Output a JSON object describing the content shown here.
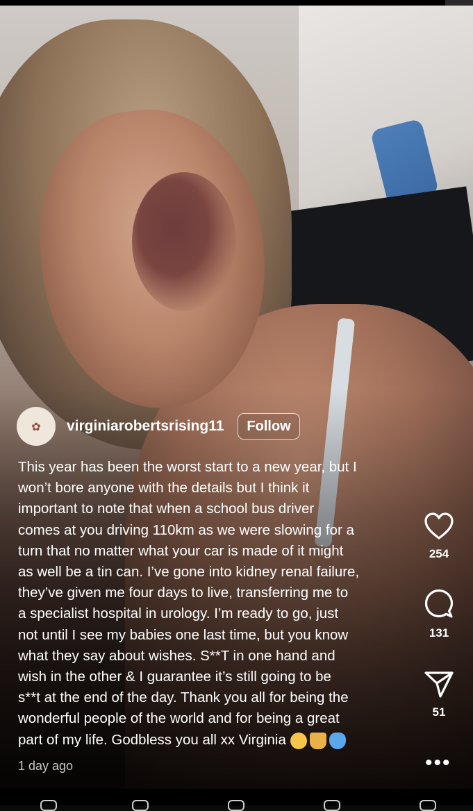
{
  "post": {
    "username": "virginiarobertsrising11",
    "follow_label": "Follow",
    "caption": "This year has been the worst start to a new year, but I\nwon’t bore anyone with the details but I think it\nimportant to note that when a school bus driver\ncomes at you driving 110km as we were slowing for a\nturn that no matter what your car is made of it might\nas well be a tin can. I’ve gone into kidney renal failure,\nthey’ve given me four days to live, transferring me to\na specialist hospital in urology. I’m ready to go, just\nnot until I see my babies one last time, but you know\nwhat they say about wishes. S**T in one hand and\nwish in the other & I guarantee it’s still going to be\ns**t at the end of the day. Thank you all for being the\nwonderful people of the world and for being a great\npart of my life. Godbless you all xx Virginia",
    "caption_emojis": [
      "pensive-face",
      "folded-hands",
      "blue-butterfly"
    ],
    "timestamp": "1 day ago"
  },
  "actions": {
    "likes": "254",
    "comments": "131",
    "shares": "51",
    "like_icon": "heart-icon",
    "comment_icon": "comment-icon",
    "share_icon": "send-icon",
    "more_icon": "more-icon"
  },
  "colors": {
    "text": "#ffffff",
    "muted_text": "#c8c8c8",
    "background": "#0b0b0b"
  }
}
